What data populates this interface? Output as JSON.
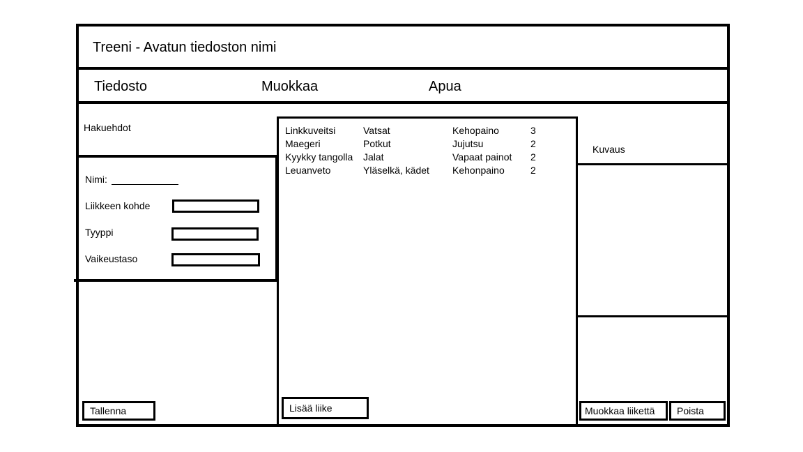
{
  "window": {
    "title": "Treeni - Avatun tiedoston nimi"
  },
  "menu": {
    "file": "Tiedosto",
    "edit": "Muokkaa",
    "help": "Apua"
  },
  "search": {
    "heading": "Hakuehdot",
    "name_label": "Nimi:",
    "target_label": "Liikkeen kohde",
    "type_label": "Tyyppi",
    "difficulty_label": "Vaikeustaso"
  },
  "exercises": [
    {
      "name": "Linkkuveitsi",
      "target": "Vatsat",
      "type": "Kehopaino",
      "difficulty": "3"
    },
    {
      "name": "Maegeri",
      "target": "Potkut",
      "type": "Jujutsu",
      "difficulty": "2"
    },
    {
      "name": "Kyykky tangolla",
      "target": "Jalat",
      "type": "Vapaat painot",
      "difficulty": "2"
    },
    {
      "name": "Leuanveto",
      "target": "Yläselkä, kädet",
      "type": "Kehonpaino",
      "difficulty": "2"
    }
  ],
  "detail": {
    "description_label": "Kuvaus"
  },
  "buttons": {
    "save": "Tallenna",
    "add_exercise": "Lisää liike",
    "edit_exercise": "Muokkaa liikettä",
    "delete": "Poista"
  }
}
